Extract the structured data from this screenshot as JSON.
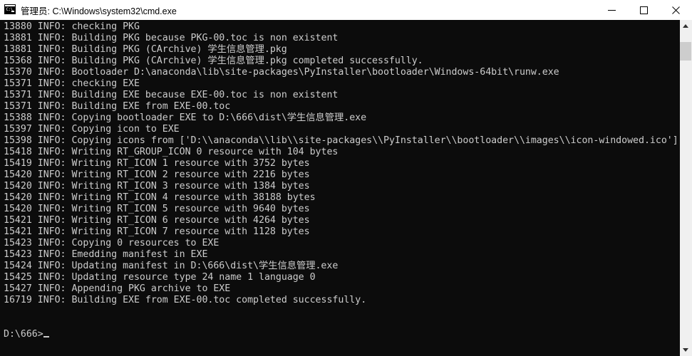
{
  "window": {
    "title": "管理员: C:\\Windows\\system32\\cmd.exe",
    "icon": "cmd-console-icon",
    "icon_label": "C:\\",
    "colors": {
      "titlebar_bg": "#ffffff",
      "titlebar_fg": "#000000",
      "console_bg": "#0c0c0c",
      "console_fg": "#cccccc",
      "scrollbar_track": "#f0f0f0",
      "scrollbar_thumb": "#cdcdcd"
    },
    "controls": {
      "minimize": "minimize-icon",
      "maximize": "maximize-icon",
      "close": "close-icon"
    }
  },
  "console": {
    "lines": [
      "13880 INFO: checking PKG",
      "13881 INFO: Building PKG because PKG-00.toc is non existent",
      "13881 INFO: Building PKG (CArchive) 学生信息管理.pkg",
      "15368 INFO: Building PKG (CArchive) 学生信息管理.pkg completed successfully.",
      "15370 INFO: Bootloader D:\\anaconda\\lib\\site-packages\\PyInstaller\\bootloader\\Windows-64bit\\runw.exe",
      "15371 INFO: checking EXE",
      "15371 INFO: Building EXE because EXE-00.toc is non existent",
      "15371 INFO: Building EXE from EXE-00.toc",
      "15388 INFO: Copying bootloader EXE to D:\\666\\dist\\学生信息管理.exe",
      "15397 INFO: Copying icon to EXE",
      "15398 INFO: Copying icons from ['D:\\\\anaconda\\\\lib\\\\site-packages\\\\PyInstaller\\\\bootloader\\\\images\\\\icon-windowed.ico']",
      "15418 INFO: Writing RT_GROUP_ICON 0 resource with 104 bytes",
      "15419 INFO: Writing RT_ICON 1 resource with 3752 bytes",
      "15420 INFO: Writing RT_ICON 2 resource with 2216 bytes",
      "15420 INFO: Writing RT_ICON 3 resource with 1384 bytes",
      "15420 INFO: Writing RT_ICON 4 resource with 38188 bytes",
      "15420 INFO: Writing RT_ICON 5 resource with 9640 bytes",
      "15421 INFO: Writing RT_ICON 6 resource with 4264 bytes",
      "15421 INFO: Writing RT_ICON 7 resource with 1128 bytes",
      "15423 INFO: Copying 0 resources to EXE",
      "15423 INFO: Emedding manifest in EXE",
      "15424 INFO: Updating manifest in D:\\666\\dist\\学生信息管理.exe",
      "15425 INFO: Updating resource type 24 name 1 language 0",
      "15427 INFO: Appending PKG archive to EXE",
      "16719 INFO: Building EXE from EXE-00.toc completed successfully.",
      "",
      ""
    ],
    "prompt": "D:\\666>"
  },
  "scrollbar": {
    "up_arrow": "scroll-up-icon",
    "down_arrow": "scroll-down-icon"
  }
}
